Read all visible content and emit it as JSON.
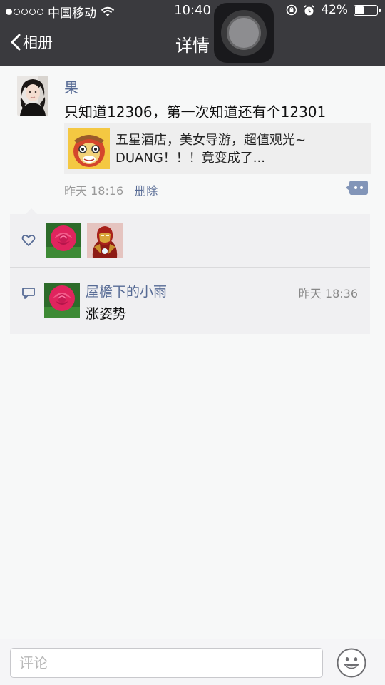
{
  "status_bar": {
    "carrier": "中国移动",
    "time": "10:40",
    "battery": "42%",
    "battery_level": 0.42,
    "signal_dots_filled": 1,
    "signal_dots_total": 5
  },
  "nav": {
    "back_label": "相册",
    "title": "详情"
  },
  "post": {
    "author": "果",
    "text": "只知道12306，第一次知道还有个12301",
    "link": {
      "line1": "五星酒店，美女导游，超值观光~",
      "line2": "DUANG！！！竟变成了..."
    },
    "time": "昨天 18:16",
    "delete_label": "删除"
  },
  "likes": {
    "count": 2
  },
  "comments": [
    {
      "name": "屋檐下的小雨",
      "time": "昨天 18:36",
      "text": "涨姿势"
    }
  ],
  "input": {
    "placeholder": "评论"
  },
  "colors": {
    "nav_bg": "#3a3a3e",
    "link_blue": "#576b95",
    "page_bg": "#f7f8f8",
    "interaction_bg": "#f0f0f2"
  }
}
